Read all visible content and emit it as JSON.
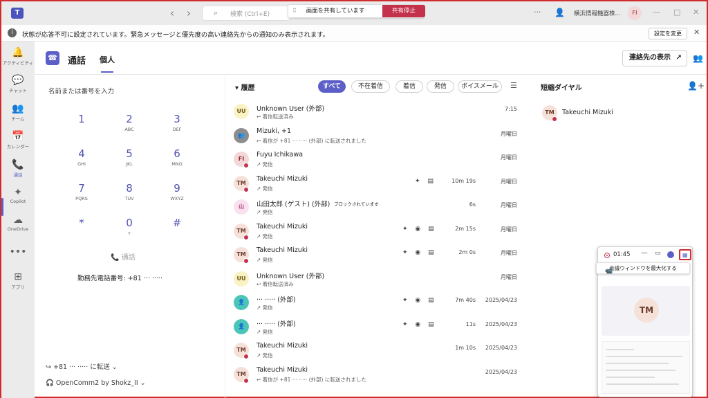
{
  "titlebar": {
    "logo": "T",
    "back": "‹",
    "forward": "›",
    "search_placeholder": "検索 (Ctrl+E)",
    "share_status": "画面を共有しています",
    "stop_share": "共有停止",
    "more": "···",
    "org_name": "横浜情報機器株...",
    "avatar_initials": "FI",
    "minimize": "—",
    "maximize": "□",
    "close": "✕"
  },
  "notification": {
    "text": "状態が応答不可に設定されています。緊急メッセージと優先度の高い連絡先からの通知のみ表示されます。",
    "settings_button": "設定を変更",
    "close": "✕"
  },
  "appbar": {
    "items": [
      {
        "label": "アクティビティ",
        "icon": "🔔"
      },
      {
        "label": "チャット",
        "icon": "💬"
      },
      {
        "label": "チーム",
        "icon": "👥"
      },
      {
        "label": "カレンダー",
        "icon": "📅"
      },
      {
        "label": "通話",
        "icon": "📞"
      },
      {
        "label": "Copilot",
        "icon": "✦"
      },
      {
        "label": "OneDrive",
        "icon": "☁"
      },
      {
        "label": "",
        "icon": "•••"
      },
      {
        "label": "アプリ",
        "icon": "⊞"
      }
    ]
  },
  "header": {
    "title": "通話",
    "tab": "個人",
    "show_contacts": "連絡先の表示",
    "ext_icon": "↗"
  },
  "dialpad": {
    "label": "名前または番号を入力",
    "keys": [
      {
        "digit": "1",
        "letters": ""
      },
      {
        "digit": "2",
        "letters": "ABC"
      },
      {
        "digit": "3",
        "letters": "DEF"
      },
      {
        "digit": "4",
        "letters": "GHI"
      },
      {
        "digit": "5",
        "letters": "JKL"
      },
      {
        "digit": "6",
        "letters": "MNO"
      },
      {
        "digit": "7",
        "letters": "PQRS"
      },
      {
        "digit": "8",
        "letters": "TUV"
      },
      {
        "digit": "9",
        "letters": "WXYZ"
      },
      {
        "digit": "*",
        "letters": ""
      },
      {
        "digit": "0",
        "letters": "+"
      },
      {
        "digit": "#",
        "letters": ""
      }
    ],
    "call_button": "📞 通話",
    "work_number": "勤務先電話番号: +81 ··· ·····",
    "forward": "↪  +81 ··· ····· に転送 ⌄",
    "device": "🎧  OpenComm2 by Shokz_II ⌄"
  },
  "history": {
    "title": "▾  履歴",
    "filters": [
      "すべて",
      "不在着信",
      "着信",
      "発信",
      "ボイスメール"
    ],
    "filter_icon": "☰",
    "rows": [
      {
        "initials": "UU",
        "type": "uu",
        "name": "Unknown User (外部)",
        "sub": "↩ 着信転送済み",
        "duration": "",
        "date": "7:15",
        "presence": false,
        "icons": ""
      },
      {
        "initials": "👥",
        "type": "grp",
        "name": "Mizuki, +1",
        "sub": "↩ 着信が +81 ··· ····· (外部) に転送されました",
        "duration": "",
        "date": "月曜日",
        "presence": false,
        "icons": ""
      },
      {
        "initials": "FI",
        "type": "fi",
        "name": "Fuyu Ichikawa",
        "sub": "↗ 発信",
        "duration": "",
        "date": "月曜日",
        "presence": true,
        "icons": ""
      },
      {
        "initials": "TM",
        "type": "tm",
        "name": "Takeuchi Mizuki",
        "sub": "↗ 発信",
        "duration": "10m 19s",
        "date": "月曜日",
        "presence": true,
        "icons": "✦ ▤"
      },
      {
        "initials": "山",
        "type": "yama",
        "name": "山田太郎 (ゲスト) (外部)",
        "sub": "↗ 発信",
        "duration": "6s",
        "date": "月曜日",
        "presence": false,
        "icons": "",
        "blocked": "ブロックされています"
      },
      {
        "initials": "TM",
        "type": "tm",
        "name": "Takeuchi Mizuki",
        "sub": "↗ 発信",
        "duration": "2m 15s",
        "date": "月曜日",
        "presence": true,
        "icons": "✦ ◉ ▤"
      },
      {
        "initials": "TM",
        "type": "tm",
        "name": "Takeuchi Mizuki",
        "sub": "↗ 発信",
        "duration": "2m 0s",
        "date": "月曜日",
        "presence": true,
        "icons": "✦ ◉ ▤"
      },
      {
        "initials": "UU",
        "type": "uu",
        "name": "Unknown User (外部)",
        "sub": "↩ 着信転送済み",
        "duration": "",
        "date": "月曜日",
        "presence": false,
        "icons": ""
      },
      {
        "initials": "👤",
        "type": "tq",
        "name": "··· ····· (外部)",
        "sub": "↗ 発信",
        "duration": "7m 40s",
        "date": "2025/04/23",
        "presence": false,
        "icons": "✦ ◉ ▤"
      },
      {
        "initials": "👤",
        "type": "tq",
        "name": "··· ····· (外部)",
        "sub": "↗ 発信",
        "duration": "11s",
        "date": "2025/04/23",
        "presence": false,
        "icons": "✦ ◉ ▤"
      },
      {
        "initials": "TM",
        "type": "tm",
        "name": "Takeuchi Mizuki",
        "sub": "↗ 発信",
        "duration": "1m 10s",
        "date": "2025/04/23",
        "presence": true,
        "icons": ""
      },
      {
        "initials": "TM",
        "type": "tm",
        "name": "Takeuchi Mizuki",
        "sub": "↩ 着信が +81 ··· ····· (外部) に転送されました",
        "duration": "",
        "date": "2025/04/23",
        "presence": true,
        "icons": ""
      }
    ]
  },
  "speed_dial": {
    "title": "短縮ダイヤル",
    "add_icon": "👤+",
    "contact_initials": "TM",
    "contact_name": "Takeuchi Mizuki"
  },
  "mini_window": {
    "timer": "01:45",
    "tooltip": "会議ウィンドウを最大化する",
    "avatar": "TM",
    "camera_icon": "📹"
  },
  "colors": {
    "accent": "#5b5fc7",
    "stop_share": "#c4314b",
    "presence_busy": "#c4314b"
  }
}
